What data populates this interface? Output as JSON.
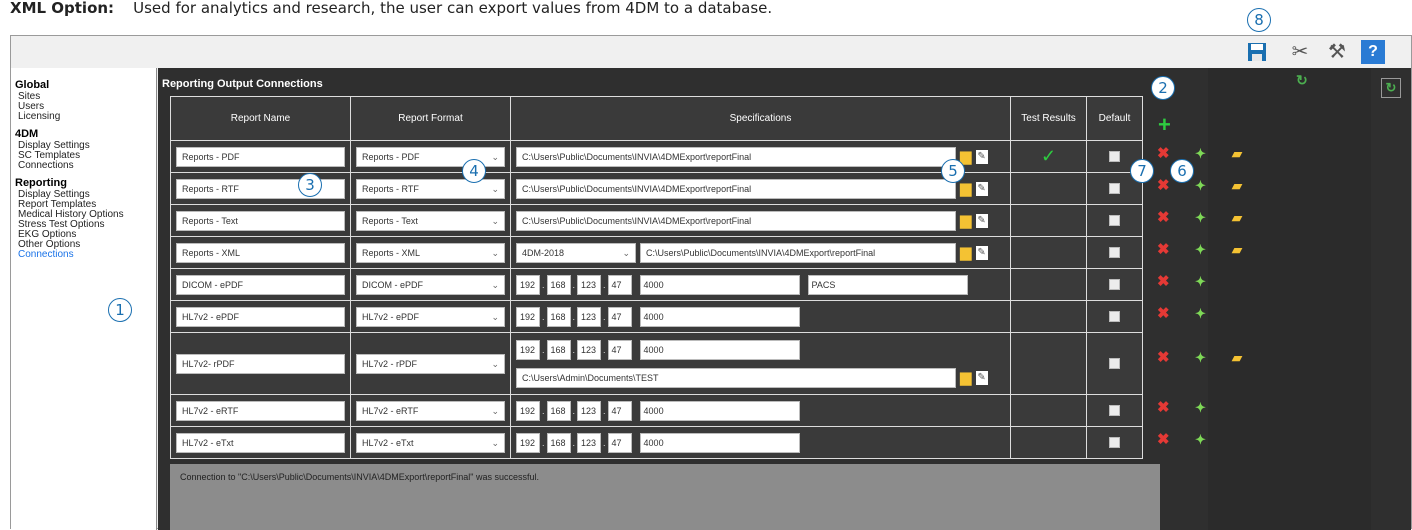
{
  "caption": {
    "bold": "XML Option:",
    "text": "Used for analytics and research, the user can export values from 4DM to a database."
  },
  "toolbar": {
    "save_icon": "save-icon",
    "tools1_icon": "tools-icon",
    "tools2_icon": "hammer-icon",
    "help_label": "?"
  },
  "sidebar": {
    "global_header": "Global",
    "global_items": [
      "Sites",
      "Users",
      "Licensing"
    ],
    "fourdm_header": "4DM",
    "fourdm_items": [
      "Display Settings",
      "SC Templates",
      "Connections"
    ],
    "reporting_header": "Reporting",
    "reporting_items": [
      "Display Settings",
      "Report Templates",
      "Medical History Options",
      "Stress Test Options",
      "EKG Options",
      "Other Options",
      "Connections"
    ]
  },
  "main": {
    "title": "Reporting Output Connections",
    "columns": [
      "Report Name",
      "Report Format",
      "Specifications",
      "Test Results",
      "Default"
    ],
    "path_public": "C:\\Users\\Public\\Documents\\INVIA\\4DMExport\\reportFinal",
    "path_admin": "C:\\Users\\Admin\\Documents\\TEST",
    "xml_version": "4DM-2018",
    "ip": [
      "192",
      "168",
      "123",
      "47"
    ],
    "port": "4000",
    "pacs": "PACS",
    "rows": [
      {
        "name": "Reports - PDF",
        "format": "Reports - PDF"
      },
      {
        "name": "Reports - RTF",
        "format": "Reports - RTF"
      },
      {
        "name": "Reports - Text",
        "format": "Reports - Text"
      },
      {
        "name": "Reports - XML",
        "format": "Reports - XML"
      },
      {
        "name": "DICOM - ePDF",
        "format": "DICOM - ePDF"
      },
      {
        "name": "HL7v2 - ePDF",
        "format": "HL7v2 - ePDF"
      },
      {
        "name": "HL7v2- rPDF",
        "format": "HL7v2 - rPDF"
      },
      {
        "name": "HL7v2 - eRTF",
        "format": "HL7v2 - eRTF"
      },
      {
        "name": "HL7v2 - eTxt",
        "format": "HL7v2 - eTxt"
      }
    ],
    "status": "Connection to \"C:\\Users\\Public\\Documents\\INVIA\\4DMExport\\reportFinal\" was successful."
  },
  "badges": [
    "1",
    "2",
    "3",
    "4",
    "5",
    "6",
    "7",
    "8"
  ],
  "colors": {
    "accent_blue": "#1a6fb0",
    "dark_bg": "#2f2f2f",
    "delete_red": "#e53935",
    "add_green": "#2ecc40"
  }
}
